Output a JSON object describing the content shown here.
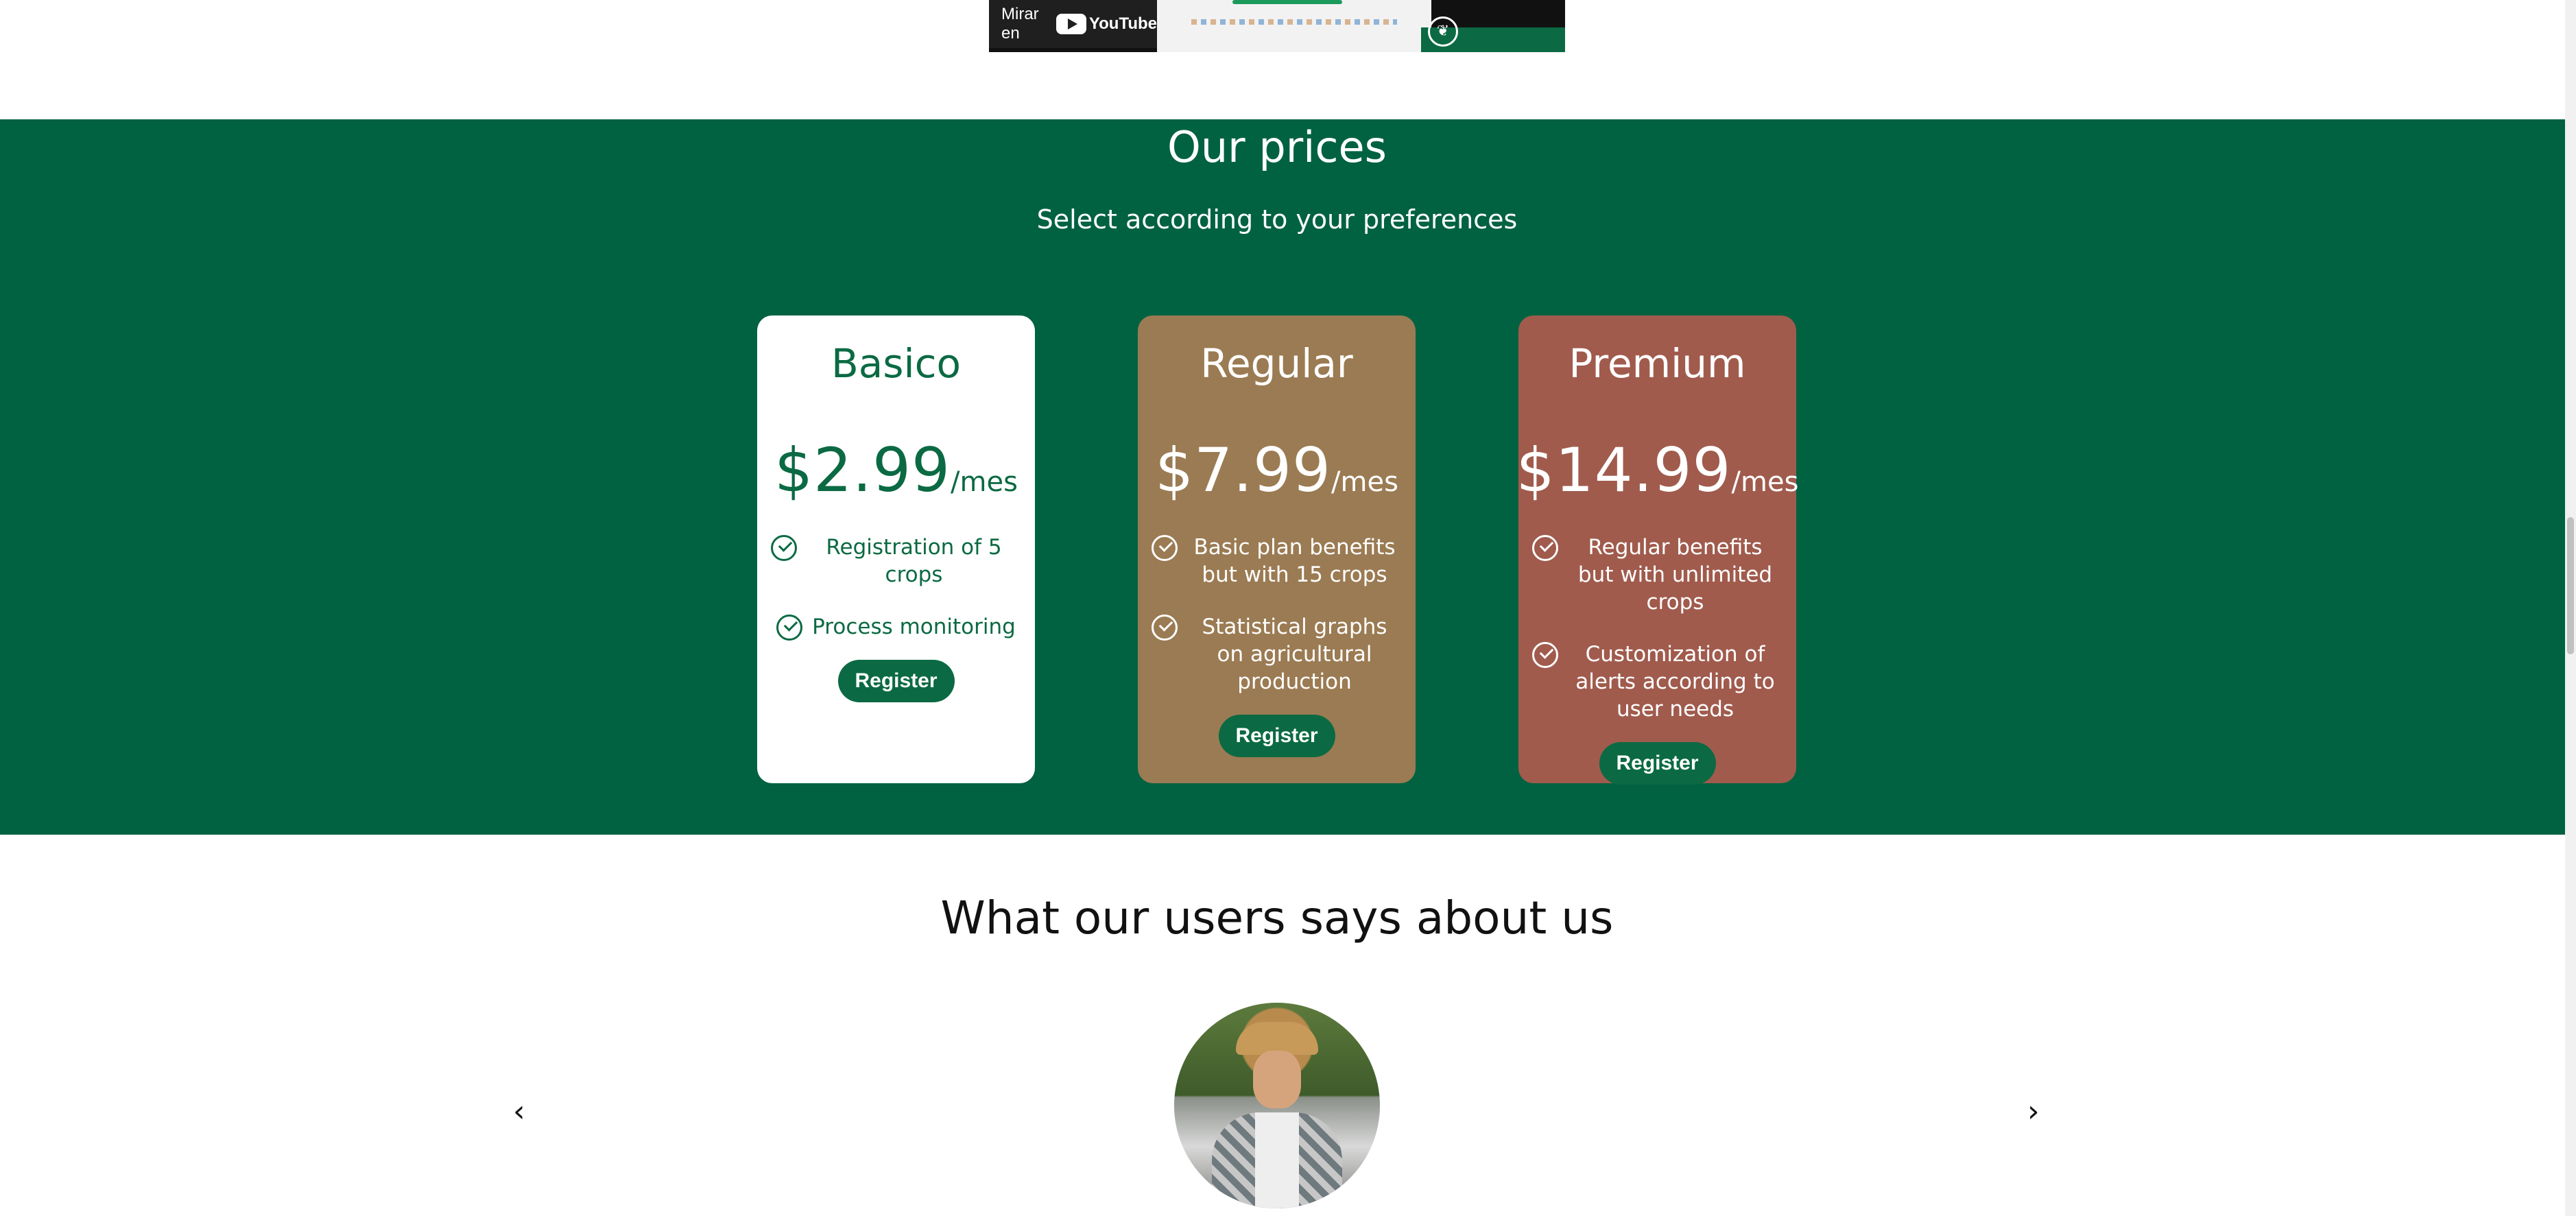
{
  "video": {
    "watch_label": "Mirar en",
    "youtube_label": "YouTube"
  },
  "prices": {
    "title": "Our prices",
    "subtitle": "Select according to your preferences",
    "plans": [
      {
        "name": "Basico",
        "price": "$2.99",
        "period": "/mes",
        "features": [
          "Registration of 5 crops",
          "Process monitoring"
        ],
        "button": "Register"
      },
      {
        "name": "Regular",
        "price": "$7.99",
        "period": "/mes",
        "features": [
          "Basic plan benefits but with 15 crops",
          "Statistical graphs on agricultural production"
        ],
        "button": "Register"
      },
      {
        "name": "Premium",
        "price": "$14.99",
        "period": "/mes",
        "features": [
          "Regular benefits but with unlimited crops",
          "Customization of alerts according to user needs"
        ],
        "button": "Register"
      }
    ]
  },
  "testimonials": {
    "title": "What our users says about us",
    "prev_label": "‹",
    "next_label": "›"
  },
  "colors": {
    "brand_green": "#006241",
    "regular_card": "#9b7b53",
    "premium_card": "#a05b4d"
  }
}
